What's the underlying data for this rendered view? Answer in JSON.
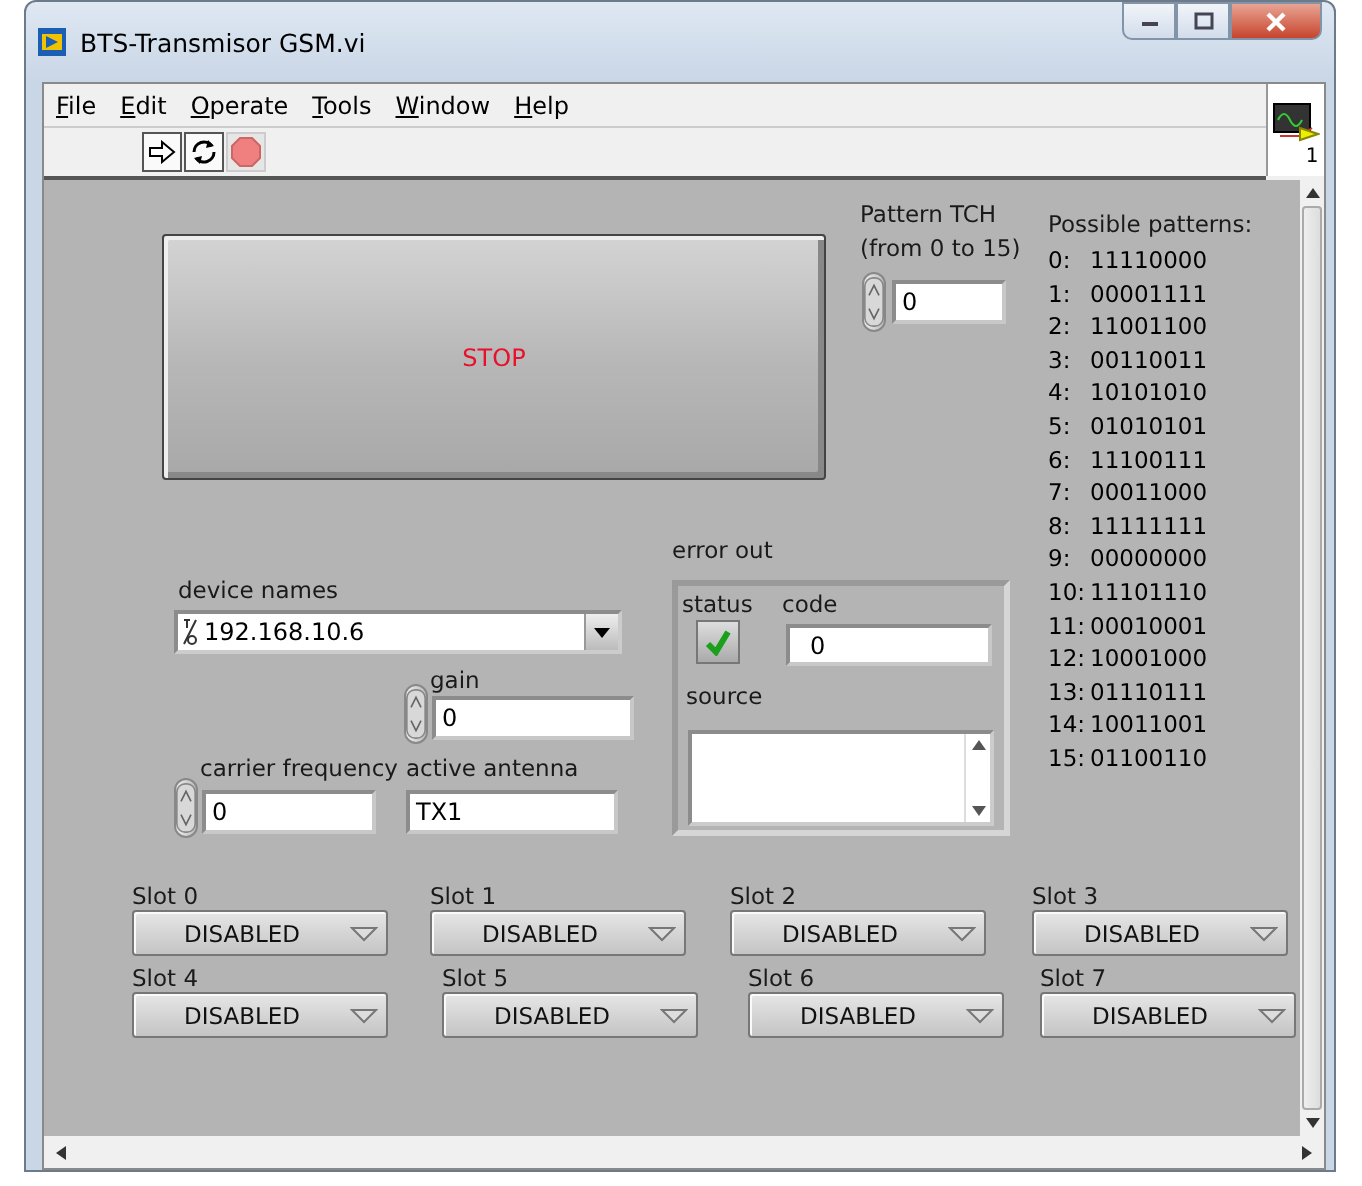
{
  "window": {
    "title": "BTS-Transmisor GSM.vi"
  },
  "menu": [
    {
      "label": "File"
    },
    {
      "label": "Edit"
    },
    {
      "label": "Operate"
    },
    {
      "label": "Tools"
    },
    {
      "label": "Window"
    },
    {
      "label": "Help"
    }
  ],
  "connector_pane": {
    "label": "1"
  },
  "stop_button": {
    "label": "STOP"
  },
  "pattern_tch": {
    "label_line1": "Pattern TCH",
    "label_line2": "(from 0 to 15)",
    "value": "0"
  },
  "possible_patterns": {
    "title": "Possible patterns:",
    "items": [
      {
        "index": "0:",
        "bits": "11110000"
      },
      {
        "index": "1:",
        "bits": "00001111"
      },
      {
        "index": "2:",
        "bits": "11001100"
      },
      {
        "index": "3:",
        "bits": "00110011"
      },
      {
        "index": "4:",
        "bits": "10101010"
      },
      {
        "index": "5:",
        "bits": "01010101"
      },
      {
        "index": "6:",
        "bits": "11100111"
      },
      {
        "index": "7:",
        "bits": "00011000"
      },
      {
        "index": "8:",
        "bits": "11111111"
      },
      {
        "index": "9:",
        "bits": "00000000"
      },
      {
        "index": "10:",
        "bits": "11101110"
      },
      {
        "index": "11:",
        "bits": "00010001"
      },
      {
        "index": "12:",
        "bits": "10001000"
      },
      {
        "index": "13:",
        "bits": "01110111"
      },
      {
        "index": "14:",
        "bits": "10011001"
      },
      {
        "index": "15:",
        "bits": "01100110"
      }
    ]
  },
  "error_out": {
    "label": "error out",
    "status_label": "status",
    "status_ok": true,
    "code_label": "code",
    "code": "0",
    "source_label": "source"
  },
  "device_names": {
    "label": "device names",
    "value": "192.168.10.6"
  },
  "gain": {
    "label": "gain",
    "value": "0"
  },
  "carrier_frequency": {
    "label": "carrier frequency",
    "value": "0"
  },
  "active_antenna": {
    "label": "active antenna",
    "value": "TX1"
  },
  "slots": [
    {
      "label": "Slot 0",
      "value": "DISABLED"
    },
    {
      "label": "Slot 1",
      "value": "DISABLED"
    },
    {
      "label": "Slot 2",
      "value": "DISABLED"
    },
    {
      "label": "Slot 3",
      "value": "DISABLED"
    },
    {
      "label": "Slot 4",
      "value": "DISABLED"
    },
    {
      "label": "Slot 5",
      "value": "DISABLED"
    },
    {
      "label": "Slot 6",
      "value": "DISABLED"
    },
    {
      "label": "Slot 7",
      "value": "DISABLED"
    }
  ]
}
